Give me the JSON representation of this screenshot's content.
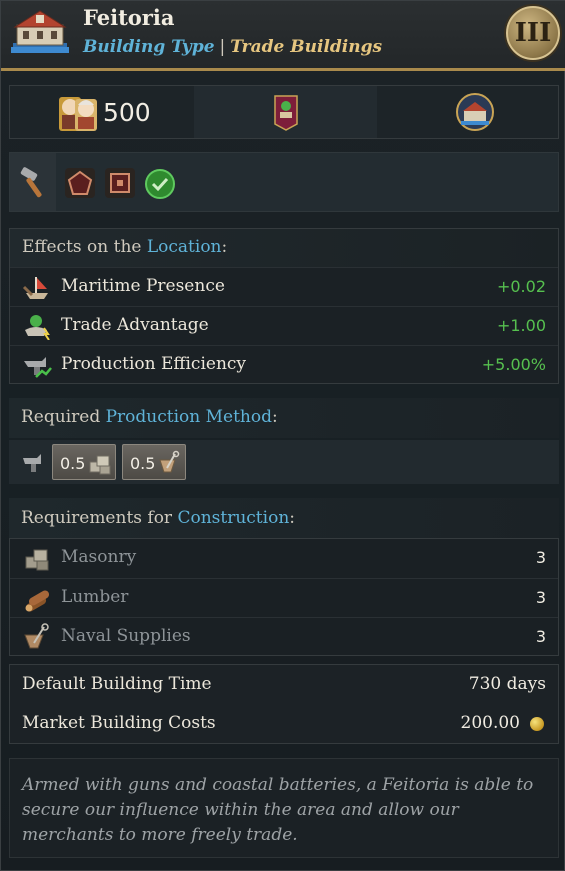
{
  "header": {
    "title": "Feitoria",
    "type_label": "Building Type",
    "separator": "|",
    "category": "Trade Buildings",
    "tier": "III",
    "icon": "coastal-fort-icon"
  },
  "cost": {
    "value": "500",
    "icons": [
      "population-icon",
      "trade-banner-icon",
      "location-emblem-icon"
    ]
  },
  "tags": {
    "icons": [
      "hammer-icon",
      "pentagon-icon",
      "square-icon",
      "check-circle-icon"
    ]
  },
  "effects": {
    "title_prefix": "Effects on the ",
    "title_highlight": "Location",
    "title_suffix": ":",
    "rows": [
      {
        "label": "Maritime Presence",
        "value": "+0.02",
        "icon": "ship-anchor-icon"
      },
      {
        "label": "Trade Advantage",
        "value": "+1.00",
        "icon": "trade-advantage-icon"
      },
      {
        "label": "Production Efficiency",
        "value": "+5.00%",
        "icon": "production-efficiency-icon"
      }
    ]
  },
  "production_method": {
    "title_prefix": "Required ",
    "title_highlight": "Production Method",
    "title_suffix": ":",
    "inputs": [
      {
        "amount": "0.5",
        "icon": "masonry-icon"
      },
      {
        "amount": "0.5",
        "icon": "naval-supplies-icon"
      }
    ]
  },
  "requirements": {
    "title_prefix": "Requirements for ",
    "title_highlight": "Construction",
    "title_suffix": ":",
    "rows": [
      {
        "label": "Masonry",
        "value": "3",
        "icon": "masonry-icon"
      },
      {
        "label": "Lumber",
        "value": "3",
        "icon": "lumber-icon"
      },
      {
        "label": "Naval Supplies",
        "value": "3",
        "icon": "naval-supplies-icon"
      }
    ]
  },
  "info": {
    "build_time_label": "Default Building Time",
    "build_time_value": "730 days",
    "market_cost_label": "Market Building Costs",
    "market_cost_value": "200.00"
  },
  "description": "Armed with guns and coastal batteries, a Feitoria is able to secure our influence within the area and allow our merchants to more freely trade.",
  "colors": {
    "accent_blue": "#5fb3d8",
    "positive_green": "#56c04f",
    "gold_border": "#a98a4c"
  }
}
